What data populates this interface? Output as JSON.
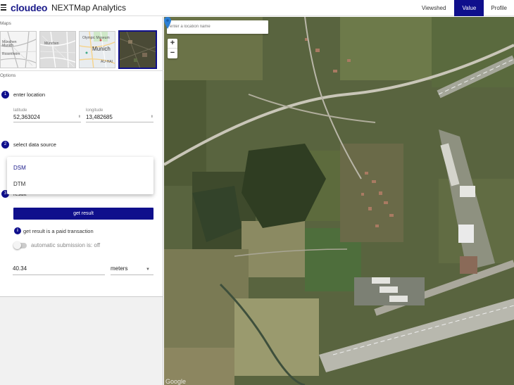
{
  "header": {
    "logo": "cloudeo",
    "title": "NEXTMap Analytics",
    "nav": [
      {
        "label": "Viewshed",
        "active": false
      },
      {
        "label": "Value",
        "active": true
      },
      {
        "label": "Profile",
        "active": false
      }
    ]
  },
  "maps_section": {
    "label": "Maps",
    "thumbnails": [
      {
        "name": "street-map",
        "labels": [
          "München",
          "Munich",
          "Rosenheim"
        ]
      },
      {
        "name": "gray-map",
        "labels": [
          "München"
        ]
      },
      {
        "name": "color-map",
        "labels": [
          "Olympic Museum",
          "Munich",
          "AU-HAI"
        ]
      },
      {
        "name": "satellite-map",
        "labels": []
      }
    ]
  },
  "options_section": {
    "label": "Options",
    "steps": [
      {
        "number": "1",
        "label": "enter location"
      },
      {
        "number": "2",
        "label": "select data source"
      },
      {
        "number": "3",
        "label": "result"
      }
    ],
    "latitude": {
      "label": "latitude",
      "value": "52,363024"
    },
    "longitude": {
      "label": "longitude",
      "value": "13,482685"
    },
    "data_source_options": [
      {
        "label": "DSM",
        "selected": true
      },
      {
        "label": "DTM",
        "selected": false
      }
    ],
    "result_button": "get result",
    "info_text": "get result is a paid transaction",
    "info_icon": "i",
    "auto_submission": "automatic submission is: off",
    "result_value": "40.34",
    "unit": "meters"
  },
  "map": {
    "search_placeholder": "enter a location name",
    "zoom_in": "+",
    "zoom_out": "−",
    "attribution": "Google"
  },
  "colors": {
    "accent": "#0f0f8c",
    "marker": "#2c7fd4"
  }
}
